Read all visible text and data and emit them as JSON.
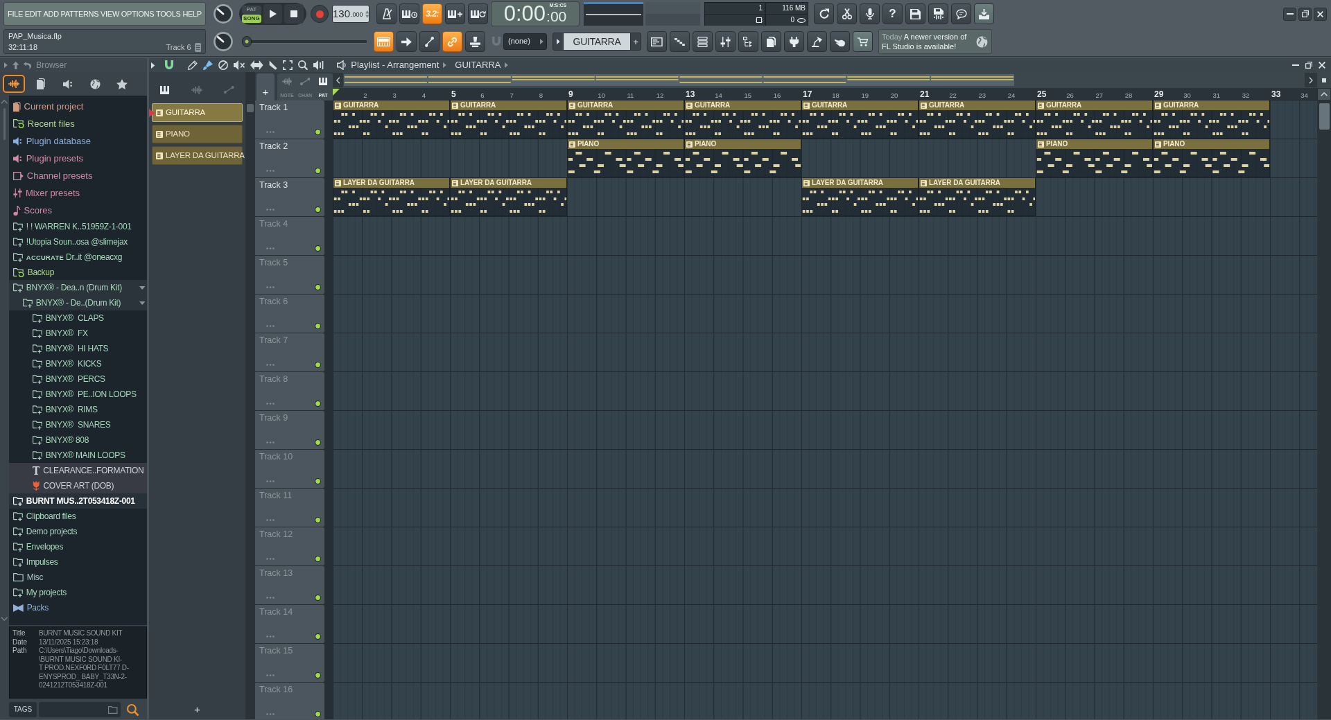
{
  "menu": [
    "FILE",
    "EDIT",
    "ADD",
    "PATTERNS",
    "VIEW",
    "OPTIONS",
    "TOOLS",
    "HELP"
  ],
  "project": {
    "file": "PAP_Musica.flp",
    "time": "32:11:18",
    "hint": "Track 6"
  },
  "transport": {
    "modes": [
      {
        "label": "PAT",
        "selected": false
      },
      {
        "label": "SONG",
        "selected": true
      }
    ],
    "tempo": "130",
    "tempo_decimals": ".000"
  },
  "top_toggles": [
    {
      "kind": "metronome",
      "on": false
    },
    {
      "kind": "wait",
      "on": false
    },
    {
      "kind": "countdown",
      "label": "3.2:",
      "on": true
    },
    {
      "kind": "blend",
      "on": false
    },
    {
      "kind": "loop",
      "on": false
    }
  ],
  "clock": {
    "value": "0:00",
    "fraction": ":00",
    "unit": "M:S:CS"
  },
  "usage": {
    "voices": "1",
    "memory": "116 MB",
    "cpu": "0"
  },
  "top_tools": [
    {
      "kind": "refresh",
      "highlighted": false
    },
    {
      "kind": "cut",
      "highlighted": false
    },
    {
      "kind": "mic",
      "highlighted": false
    },
    {
      "kind": "help",
      "label": "?",
      "highlighted": false
    },
    {
      "kind": "save",
      "highlighted": false
    },
    {
      "kind": "export",
      "highlighted": false
    },
    {
      "kind": "chat",
      "highlighted": false
    },
    {
      "kind": "download",
      "highlighted": true
    }
  ],
  "pitch_slider": {
    "level": 0
  },
  "edit_toggles": [
    {
      "kind": "keyboard",
      "on": true
    },
    {
      "kind": "arrow",
      "on": false
    },
    {
      "kind": "curve",
      "on": false
    },
    {
      "kind": "link",
      "on": true
    },
    {
      "kind": "stamp",
      "on": false
    }
  ],
  "snap": {
    "value": "(none)"
  },
  "pattern_selector": {
    "value": "GUITARRA",
    "add": "+"
  },
  "window_tools": [
    {
      "kind": "playlist",
      "highlighted": false
    },
    {
      "kind": "pianoroll",
      "highlighted": false
    },
    {
      "kind": "channels",
      "highlighted": false
    },
    {
      "kind": "mixer",
      "highlighted": false
    },
    {
      "kind": "browser",
      "highlighted": false
    },
    {
      "kind": "plugins",
      "highlighted": false
    },
    {
      "kind": "plug",
      "highlighted": false
    },
    {
      "kind": "lamp",
      "highlighted": false
    },
    {
      "kind": "touch",
      "highlighted": false
    },
    {
      "kind": "shop",
      "highlighted": true
    }
  ],
  "news": {
    "when": "Today",
    "message": "A newer version of FL Studio is available!"
  },
  "browser": {
    "title": "Browser",
    "tabs": [
      {
        "kind": "all",
        "selected": true
      },
      {
        "kind": "files",
        "selected": false
      },
      {
        "kind": "plugins",
        "selected": false
      },
      {
        "kind": "online",
        "selected": false
      },
      {
        "kind": "favorites",
        "selected": false
      }
    ],
    "items": [
      {
        "label": "Current project",
        "kind": "project",
        "expanded": false,
        "selected": false
      },
      {
        "label": "Recent files",
        "kind": "recent",
        "expanded": false,
        "selected": false
      },
      {
        "label": "Plugin database",
        "kind": "plugin-db",
        "expanded": false,
        "selected": false
      },
      {
        "label": "Plugin presets",
        "kind": "plugin-presets",
        "expanded": false,
        "selected": false
      },
      {
        "label": "Channel presets",
        "kind": "channel-presets",
        "expanded": false,
        "selected": false
      },
      {
        "label": "Mixer presets",
        "kind": "mixer-presets",
        "expanded": false,
        "selected": false
      },
      {
        "label": "Scores",
        "kind": "scores",
        "expanded": false,
        "selected": false
      },
      {
        "label": "! ! WARREN K..51959Z-1-001",
        "kind": "folder",
        "expanded": false,
        "selected": false
      },
      {
        "label": "!Utopia Soun..osa @slimejax",
        "kind": "folder",
        "expanded": false,
        "selected": false
      },
      {
        "label": "**ACCURATE** Dr..it @oneacxg",
        "kind": "folder",
        "expanded": false,
        "selected": false
      },
      {
        "label": "Backup",
        "kind": "backup",
        "expanded": false,
        "selected": false
      },
      {
        "label": "BNYX® - Dea..n (Drum Kit)",
        "kind": "folder",
        "expanded": true,
        "selected": false,
        "children": [
          {
            "label": "BNYX® - De..(Drum Kit)",
            "kind": "folder",
            "expanded": true,
            "selected": false,
            "children": [
              {
                "label": "BNYX®  CLAPS",
                "kind": "folder",
                "expanded": false,
                "selected": false
              },
              {
                "label": "BNYX®  FX",
                "kind": "folder",
                "expanded": false,
                "selected": false
              },
              {
                "label": "BNYX®  HI HATS",
                "kind": "folder",
                "expanded": false,
                "selected": false
              },
              {
                "label": "BNYX®  KICKS",
                "kind": "folder",
                "expanded": false,
                "selected": false
              },
              {
                "label": "BNYX®  PERCS",
                "kind": "folder",
                "expanded": false,
                "selected": false
              },
              {
                "label": "BNYX®  PE..ION LOOPS",
                "kind": "folder",
                "expanded": false,
                "selected": false
              },
              {
                "label": "BNYX®  RIMS",
                "kind": "folder",
                "expanded": false,
                "selected": false
              },
              {
                "label": "BNYX®  SNARES",
                "kind": "folder",
                "expanded": false,
                "selected": false
              },
              {
                "label": "BNYX® 808",
                "kind": "folder",
                "expanded": false,
                "selected": false
              },
              {
                "label": "BNYX® MAIN LOOPS",
                "kind": "folder",
                "expanded": false,
                "selected": false
              },
              {
                "label": "CLEARANCE..FORMATION",
                "kind": "text-file",
                "expanded": false,
                "selected": false
              },
              {
                "label": "COVER ART (DOB)",
                "kind": "image-file",
                "expanded": false,
                "selected": false
              }
            ]
          }
        ]
      },
      {
        "label": "BURNT MUS..2T053418Z-001",
        "kind": "folder",
        "expanded": false,
        "selected": true
      },
      {
        "label": "Clipboard files",
        "kind": "folder",
        "expanded": false,
        "selected": false
      },
      {
        "label": "Demo projects",
        "kind": "folder",
        "expanded": false,
        "selected": false
      },
      {
        "label": "Envelopes",
        "kind": "folder",
        "expanded": false,
        "selected": false
      },
      {
        "label": "Impulses",
        "kind": "folder",
        "expanded": false,
        "selected": false
      },
      {
        "label": "Misc",
        "kind": "folder-plain",
        "expanded": false,
        "selected": false
      },
      {
        "label": "My projects",
        "kind": "folder",
        "expanded": false,
        "selected": false
      },
      {
        "label": "Packs",
        "kind": "packs",
        "expanded": false,
        "selected": false
      }
    ],
    "info": [
      {
        "label": "Title",
        "lines": [
          "BURNT MUSIC SOUND KIT"
        ]
      },
      {
        "label": "Date",
        "lines": [
          "13/11/2025 15:23:18"
        ]
      },
      {
        "label": "Path",
        "lines": [
          "C:\\Users\\Tiago\\Downloads-",
          "\\BURNT MUSIC SOUND KI-",
          "T PROD.NEXF0RD F0LT77 D-",
          "ENYSPROD_ BABY_T33N-2-",
          "0241212T053418Z-001"
        ]
      }
    ],
    "tags_label": "TAGS"
  },
  "playlist": {
    "magnet": {
      "on": true
    },
    "tools": [
      {
        "kind": "pencil",
        "selected": false
      },
      {
        "kind": "paint",
        "selected": true
      },
      {
        "kind": "delete",
        "selected": false
      },
      {
        "kind": "mute",
        "selected": false
      },
      {
        "kind": "slip",
        "selected": false
      },
      {
        "kind": "slice",
        "selected": false
      },
      {
        "kind": "select",
        "selected": false
      },
      {
        "kind": "zoom",
        "selected": false
      },
      {
        "kind": "playback",
        "selected": false
      }
    ],
    "title": "Playlist - Arrangement",
    "pattern": "GUITARRA",
    "picker_tabs": [
      {
        "kind": "patterns",
        "selected": true
      },
      {
        "kind": "audio",
        "selected": false
      },
      {
        "kind": "automation",
        "selected": false
      }
    ],
    "patterns": [
      {
        "name": "GUITARRA",
        "selected": true
      },
      {
        "name": "PIANO",
        "selected": false
      },
      {
        "name": "LAYER DA GUITARRA",
        "selected": false
      }
    ],
    "picker_add": "+",
    "add_track": "+",
    "filters": [
      {
        "kind": "note",
        "label": "NOTE",
        "selected": false
      },
      {
        "kind": "channel",
        "label": "CHAN",
        "selected": false
      },
      {
        "kind": "pattern",
        "label": "PAT",
        "selected": true
      }
    ],
    "ruler": [
      "2",
      "3",
      "4",
      "5",
      "6",
      "7",
      "8",
      "9",
      "10",
      "11",
      "12",
      "13",
      "14",
      "15",
      "16",
      "17",
      "18",
      "19",
      "20",
      "21",
      "22",
      "23",
      "24",
      "25",
      "26",
      "27",
      "28",
      "29",
      "30",
      "31",
      "32",
      "33",
      "34"
    ],
    "tracks": [
      {
        "name": "Track 1",
        "enabled": true,
        "slots": [
          {
            "label": "GUITARRA",
            "kind": "riff"
          },
          {
            "label": "GUITARRA",
            "kind": "riff"
          },
          {
            "label": "GUITARRA",
            "kind": "riff"
          },
          {
            "label": "GUITARRA",
            "kind": "riff"
          },
          {
            "label": "GUITARRA",
            "kind": "riff"
          },
          {
            "label": "GUITARRA",
            "kind": "riff"
          },
          {
            "label": "GUITARRA",
            "kind": "riff"
          },
          {
            "label": "GUITARRA",
            "kind": "riff"
          }
        ]
      },
      {
        "name": "Track 2",
        "enabled": true,
        "slots": [
          {
            "kind": "empty"
          },
          {
            "kind": "empty"
          },
          {
            "label": "PIANO",
            "kind": "chords"
          },
          {
            "label": "PIANO",
            "kind": "chords"
          },
          {
            "kind": "empty"
          },
          {
            "kind": "empty"
          },
          {
            "label": "PIANO",
            "kind": "chords"
          },
          {
            "label": "PIANO",
            "kind": "chords"
          }
        ]
      },
      {
        "name": "Track 3",
        "enabled": true,
        "slots": [
          {
            "label": "LAYER DA GUITARRA",
            "kind": "riff"
          },
          {
            "label": "LAYER DA GUITARRA",
            "kind": "riff"
          },
          {
            "kind": "empty"
          },
          {
            "kind": "empty"
          },
          {
            "label": "LAYER DA GUITARRA",
            "kind": "riff"
          },
          {
            "label": "LAYER DA GUITARRA",
            "kind": "riff"
          }
        ]
      },
      {
        "name": "Track 4",
        "enabled": true
      },
      {
        "name": "Track 5",
        "enabled": true
      },
      {
        "name": "Track 6",
        "enabled": true
      },
      {
        "name": "Track 7",
        "enabled": true
      },
      {
        "name": "Track 8",
        "enabled": true
      },
      {
        "name": "Track 9",
        "enabled": true
      },
      {
        "name": "Track 10",
        "enabled": true
      },
      {
        "name": "Track 11",
        "enabled": true
      },
      {
        "name": "Track 12",
        "enabled": true
      },
      {
        "name": "Track 13",
        "enabled": true
      },
      {
        "name": "Track 14",
        "enabled": true
      },
      {
        "name": "Track 15",
        "enabled": true
      },
      {
        "name": "Track 16",
        "enabled": true
      }
    ]
  }
}
